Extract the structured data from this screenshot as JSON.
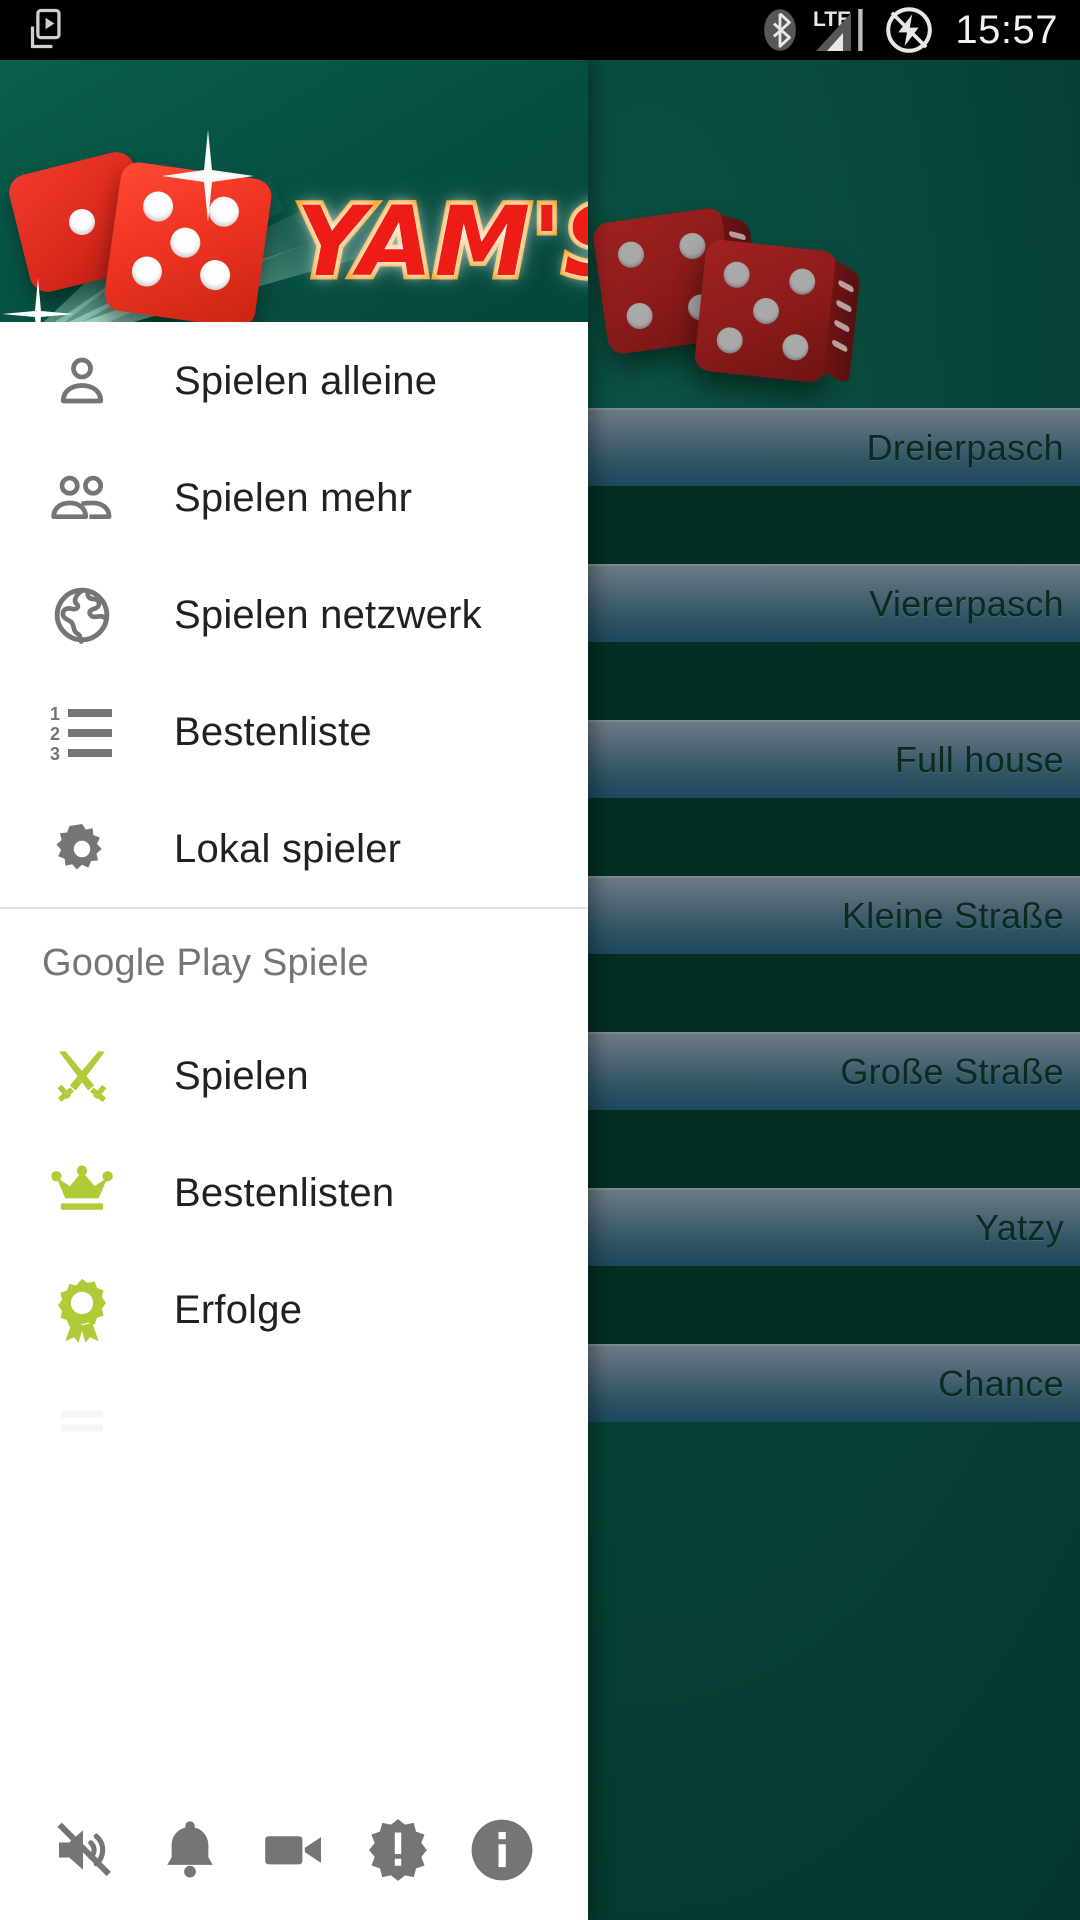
{
  "status_bar": {
    "clock": "15:57",
    "left_icons": [
      {
        "name": "play-store-cast-icon",
        "glyph": "cast"
      }
    ],
    "right_icons": [
      {
        "name": "bluetooth-icon",
        "glyph": "bluetooth"
      },
      {
        "name": "lte-signal-icon",
        "label": "LTE"
      },
      {
        "name": "battery-charging-icon",
        "glyph": "charging"
      }
    ]
  },
  "drawer": {
    "header": {
      "logo_text": "YAM'S",
      "background_color": "#075343",
      "dice_color": "#ee3320",
      "logo_fill_color": "#ee1c16",
      "logo_outline_color": "#f9a01b"
    },
    "primary_items": [
      {
        "label": "Spielen alleine",
        "icon": "person-icon"
      },
      {
        "label": "Spielen mehr",
        "icon": "people-icon"
      },
      {
        "label": "Spielen netzwerk",
        "icon": "globe-icon"
      },
      {
        "label": "Bestenliste",
        "icon": "numbered-list-icon"
      },
      {
        "label": "Lokal spieler",
        "icon": "gear-icon"
      }
    ],
    "section_title": "Google Play Spiele",
    "play_items": [
      {
        "label": "Spielen",
        "icon": "crossed-swords-icon",
        "color": "#afcb36"
      },
      {
        "label": "Bestenlisten",
        "icon": "crown-icon",
        "color": "#afcb36"
      },
      {
        "label": "Erfolge",
        "icon": "award-ribbon-icon",
        "color": "#afcb36"
      }
    ],
    "bottom_bar": [
      {
        "name": "mute-icon",
        "label": "Stumm"
      },
      {
        "name": "bell-icon",
        "label": "Benachrichtigung"
      },
      {
        "name": "video-camera-icon",
        "label": "Video"
      },
      {
        "name": "alert-badge-icon",
        "label": "Hinweis"
      },
      {
        "name": "info-icon",
        "label": "Info"
      }
    ]
  },
  "game": {
    "background_color": "#064236",
    "row_text_color": "#0c2a20",
    "score_rows": [
      "Dreierpasch",
      "Viererpasch",
      "Full house",
      "Kleine Straße",
      "Große Straße",
      "Yatzy",
      "Chance"
    ],
    "dice": [
      {
        "pips": 4,
        "color": "#8e1c1b"
      },
      {
        "pips": 5,
        "color": "#8e1c1b"
      }
    ]
  }
}
